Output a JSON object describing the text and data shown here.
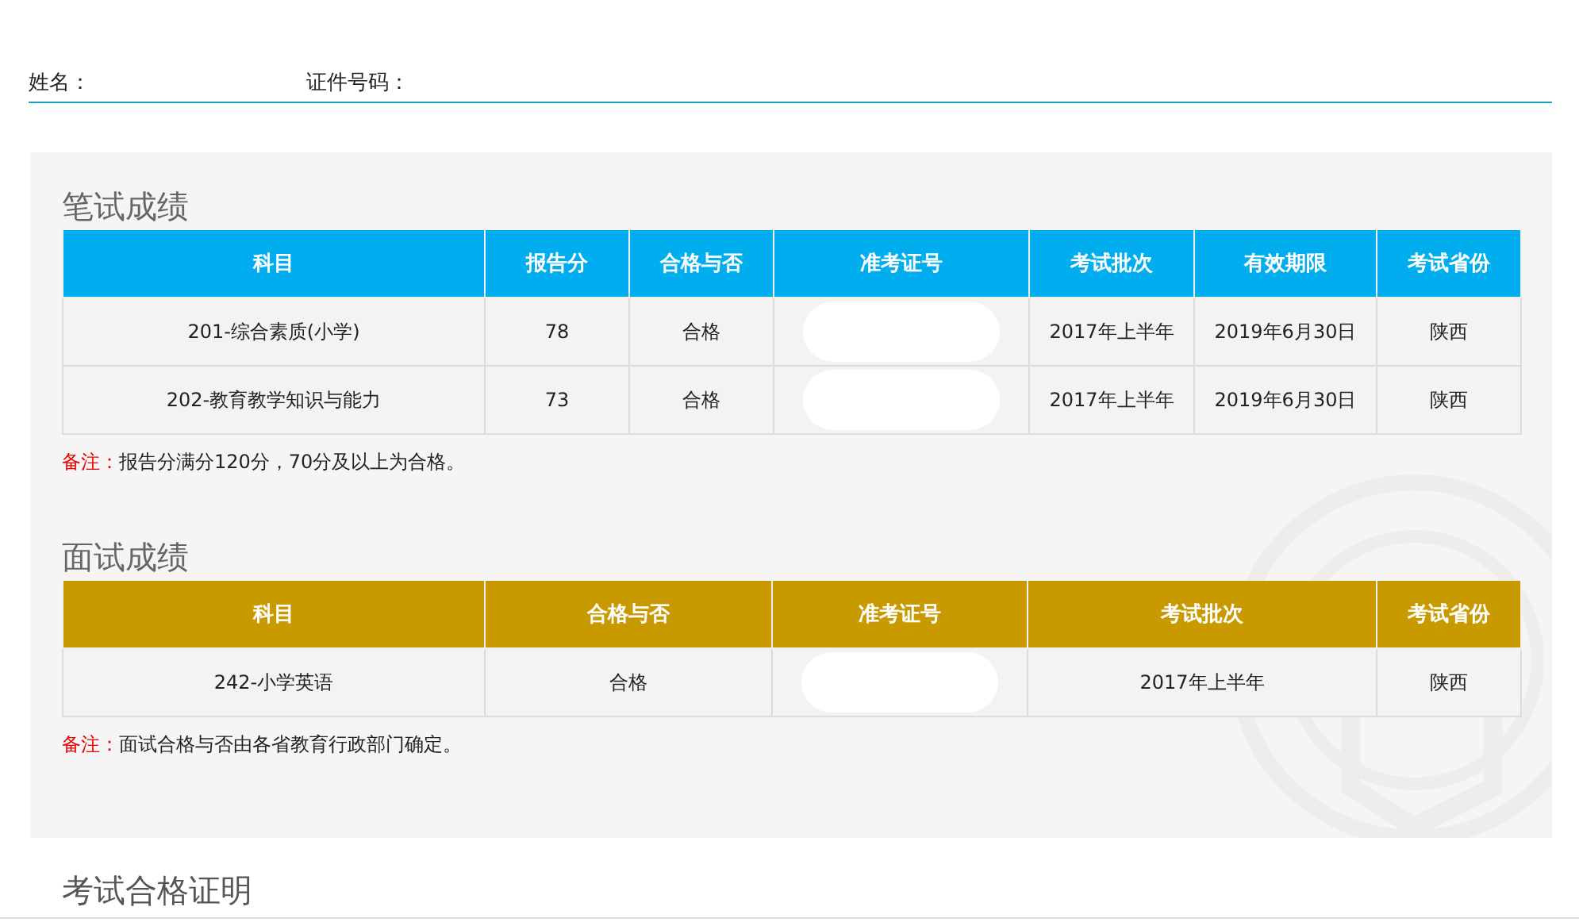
{
  "profile": [
    {
      "label": "姓名："
    },
    {
      "label": "证件号码："
    }
  ],
  "sections": [
    {
      "title": "笔试成绩",
      "kind": "written",
      "columns": [
        "科目",
        "报告分",
        "合格与否",
        "准考证号",
        "考试批次",
        "有效期限",
        "考试省份"
      ],
      "rows": [
        {
          "cells": [
            {
              "kind": "text",
              "text": "201-综合素质(小学)"
            },
            {
              "kind": "text",
              "text": "78"
            },
            {
              "kind": "text",
              "text": "合格"
            },
            {
              "kind": "redacted"
            },
            {
              "kind": "text",
              "text": "2017年上半年"
            },
            {
              "kind": "text",
              "text": "2019年6月30日"
            },
            {
              "kind": "text",
              "text": "陕西"
            }
          ]
        },
        {
          "cells": [
            {
              "kind": "text",
              "text": "202-教育教学知识与能力"
            },
            {
              "kind": "text",
              "text": "73"
            },
            {
              "kind": "text",
              "text": "合格"
            },
            {
              "kind": "redacted"
            },
            {
              "kind": "text",
              "text": "2017年上半年"
            },
            {
              "kind": "text",
              "text": "2019年6月30日"
            },
            {
              "kind": "text",
              "text": "陕西"
            }
          ]
        }
      ],
      "note": {
        "label": "备注：",
        "text": "报告分满分120分，70分及以上为合格。"
      }
    },
    {
      "title": "面试成绩",
      "kind": "interview",
      "columns": [
        "科目",
        "合格与否",
        "准考证号",
        "考试批次",
        "考试省份"
      ],
      "rows": [
        {
          "cells": [
            {
              "kind": "text",
              "text": "242-小学英语"
            },
            {
              "kind": "text",
              "text": "合格"
            },
            {
              "kind": "redacted"
            },
            {
              "kind": "text",
              "text": "2017年上半年"
            },
            {
              "kind": "text",
              "text": "陕西"
            }
          ]
        }
      ],
      "note": {
        "label": "备注：",
        "text": "面试合格与否由各省教育行政部门确定。"
      }
    }
  ],
  "next_section": {
    "title": "考试合格证明"
  }
}
